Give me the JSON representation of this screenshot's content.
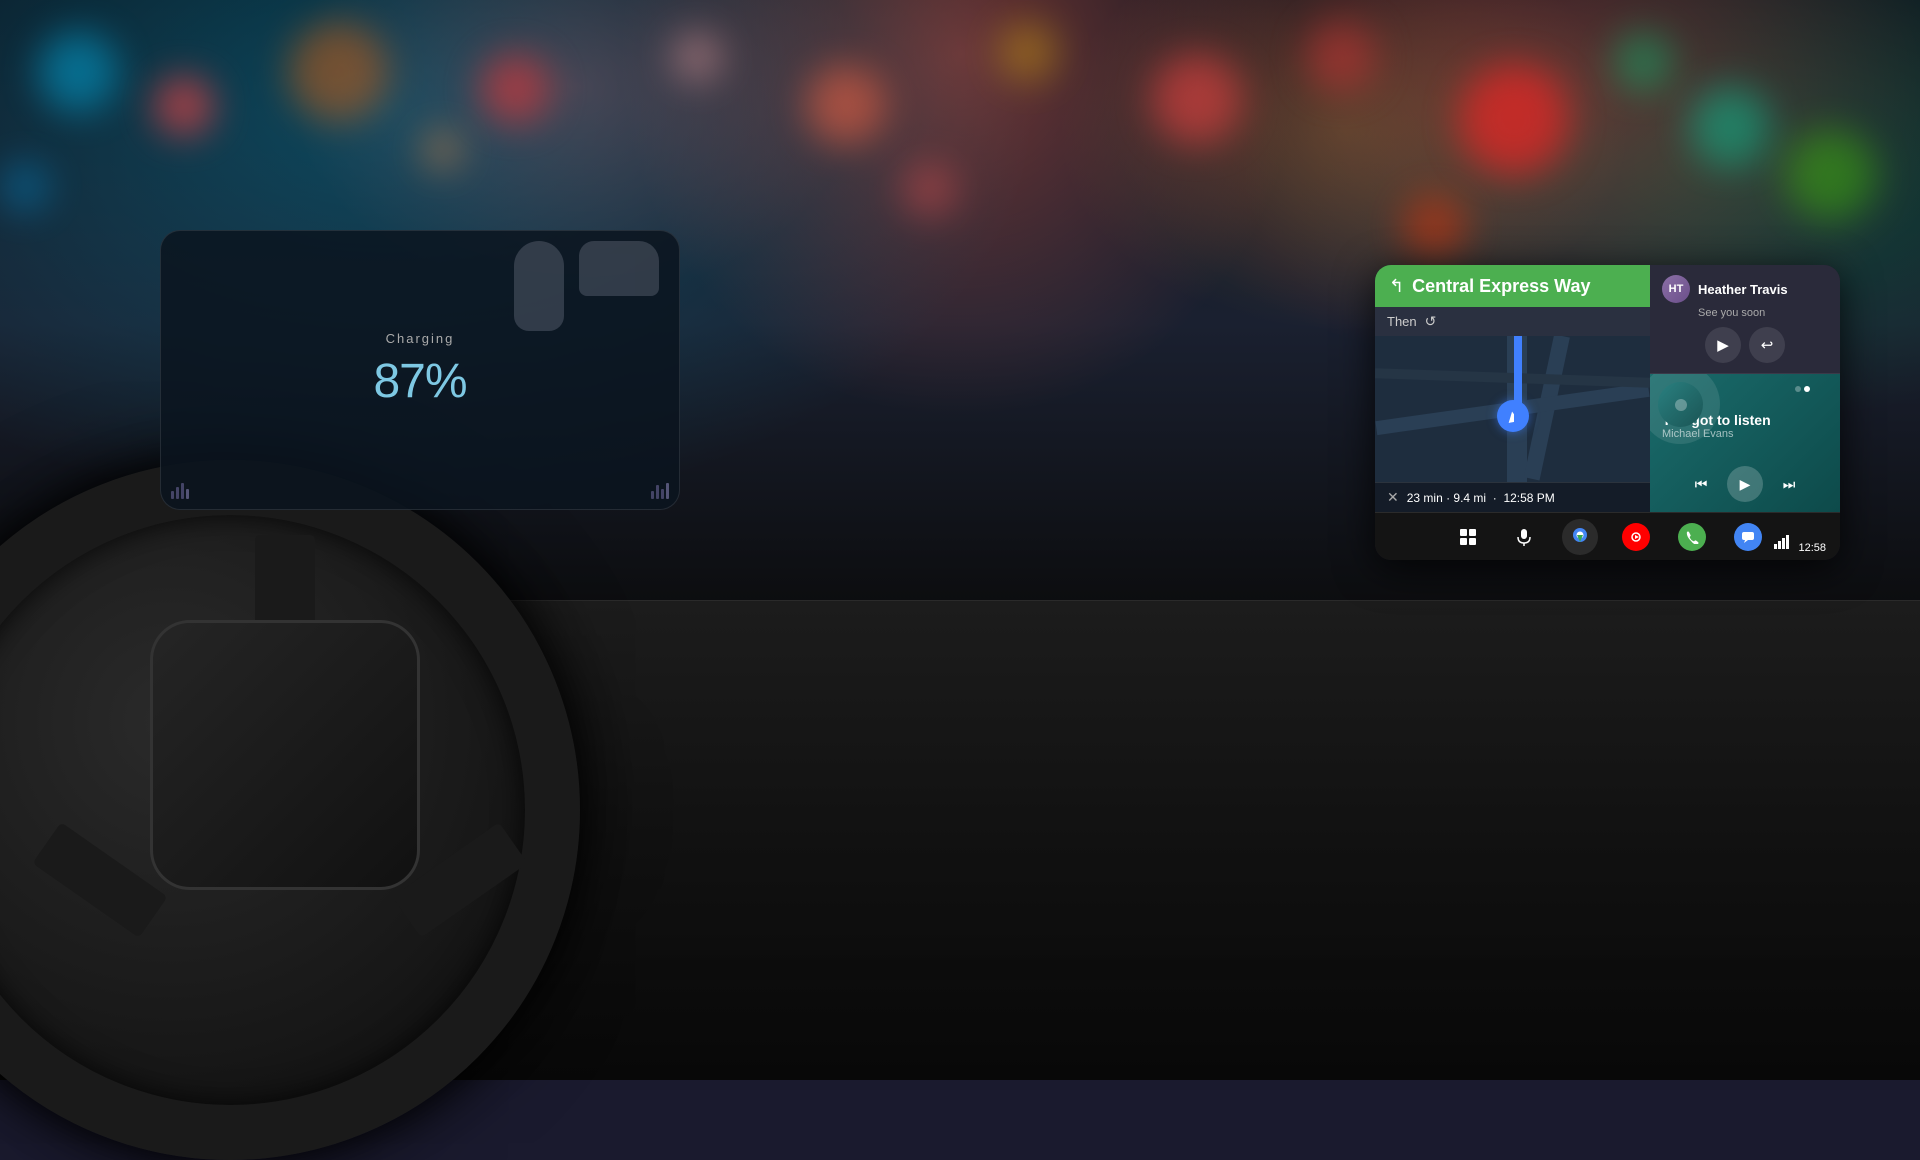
{
  "background": {
    "description": "Car interior dashboard at night with bokeh city lights"
  },
  "cluster": {
    "label": "Charging",
    "battery_percent": "87%"
  },
  "android_auto": {
    "navigation": {
      "street_name": "Central Express Way",
      "then_label": "Then",
      "eta_text": "23 min · 9.4 mi",
      "eta_time": "12:58 PM"
    },
    "message": {
      "sender_name": "Heather Travis",
      "message_text": "See you soon",
      "avatar_initials": "HT",
      "play_btn_label": "▶",
      "reply_btn_label": "↩"
    },
    "music": {
      "track_name": "You got to listen",
      "artist": "Michael Evans",
      "prev_btn": "⏮",
      "play_btn": "▶",
      "next_btn": "⏭"
    },
    "dock": {
      "grid_icon": "⊞",
      "mic_icon": "🎤",
      "maps_icon": "◉",
      "ytmusic_icon": "▶",
      "phone_icon": "📞",
      "messages_icon": "💬",
      "time": "12:58"
    }
  }
}
